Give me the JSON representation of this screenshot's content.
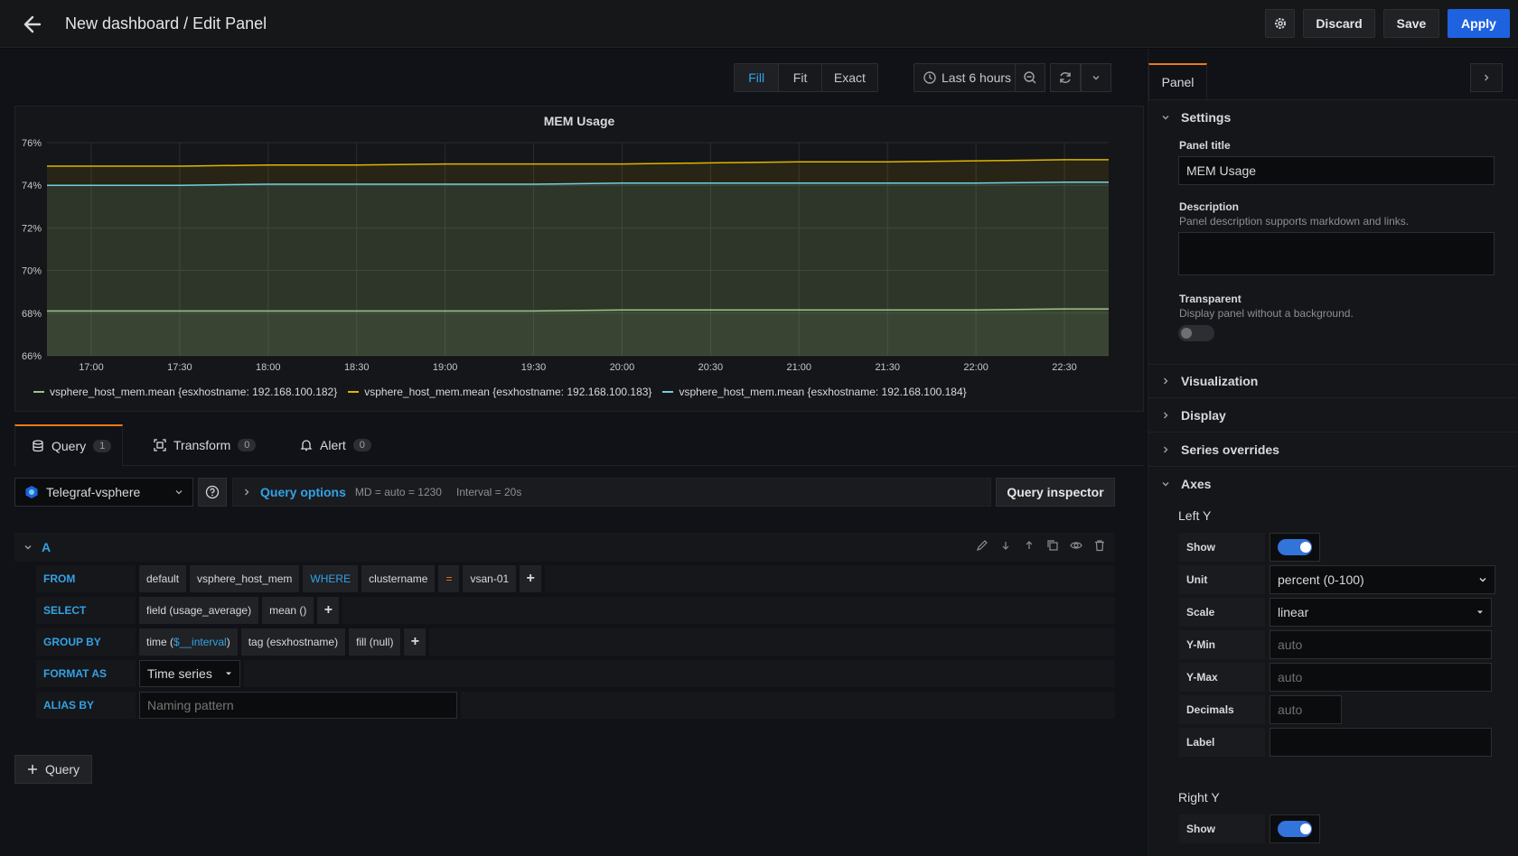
{
  "header": {
    "title": "New dashboard / Edit Panel",
    "discard_label": "Discard",
    "save_label": "Save",
    "apply_label": "Apply"
  },
  "toolbar": {
    "fill_label": "Fill",
    "fit_label": "Fit",
    "exact_label": "Exact",
    "time_range": "Last 6 hours"
  },
  "chart": {
    "title": "MEM Usage"
  },
  "chart_data": {
    "type": "area",
    "title": "MEM Usage",
    "x": [
      "17:00",
      "17:30",
      "18:00",
      "18:30",
      "19:00",
      "19:30",
      "20:00",
      "20:30",
      "21:00",
      "21:30",
      "22:00",
      "22:30"
    ],
    "y_ticks": [
      "76%",
      "74%",
      "72%",
      "70%",
      "68%",
      "66%"
    ],
    "ylim": [
      66,
      76
    ],
    "grid": true,
    "legend_position": "bottom",
    "series": [
      {
        "name": "vsphere_host_mem.mean {esxhostname: 192.168.100.182}",
        "color": "#9ac48a",
        "values": [
          68.1,
          68.1,
          68.1,
          68.1,
          68.1,
          68.1,
          68.15,
          68.15,
          68.15,
          68.15,
          68.15,
          68.2
        ]
      },
      {
        "name": "vsphere_host_mem.mean {esxhostname: 192.168.100.183}",
        "color": "#e0b400",
        "values": [
          74.9,
          74.9,
          74.95,
          74.95,
          75.0,
          75.0,
          75.0,
          75.05,
          75.1,
          75.1,
          75.15,
          75.2
        ]
      },
      {
        "name": "vsphere_host_mem.mean {esxhostname: 192.168.100.184}",
        "color": "#6ed0e0",
        "values": [
          74.0,
          74.0,
          74.05,
          74.05,
          74.05,
          74.05,
          74.1,
          74.1,
          74.1,
          74.1,
          74.1,
          74.15
        ]
      }
    ]
  },
  "tabs": [
    {
      "label": "Query",
      "count": "1"
    },
    {
      "label": "Transform",
      "count": "0"
    },
    {
      "label": "Alert",
      "count": "0"
    }
  ],
  "query_row": {
    "datasource": "Telegraf-vsphere",
    "options_label": "Query options",
    "md_info": "MD = auto = 1230",
    "interval_info": "Interval = 20s",
    "inspector_label": "Query inspector"
  },
  "query": {
    "letter": "A",
    "from": {
      "keyword": "FROM",
      "policy": "default",
      "measurement": "vsphere_host_mem",
      "where": "WHERE",
      "tag_key": "clustername",
      "operator": "=",
      "tag_value": "vsan-01"
    },
    "select": {
      "keyword": "SELECT",
      "field": "field (usage_average)",
      "func": "mean ()"
    },
    "group_by": {
      "keyword": "GROUP BY",
      "time_prefix": "time (",
      "time_var": "$__interval",
      "time_suffix": ")",
      "tag": "tag (esxhostname)",
      "fill": "fill (null)"
    },
    "format_as": {
      "keyword": "FORMAT AS",
      "value": "Time series"
    },
    "alias_by": {
      "keyword": "ALIAS BY",
      "placeholder": "Naming pattern"
    },
    "plus": "+"
  },
  "add_query_label": "Query",
  "right_pane": {
    "tab_label": "Panel",
    "settings": {
      "header": "Settings",
      "panel_title_label": "Panel title",
      "panel_title_value": "MEM Usage",
      "description_label": "Description",
      "description_help": "Panel description supports markdown and links.",
      "transparent_label": "Transparent",
      "transparent_help": "Display panel without a background."
    },
    "sections": {
      "visualization": "Visualization",
      "display": "Display",
      "series_overrides": "Series overrides",
      "axes": "Axes"
    },
    "axes": {
      "left_y": "Left Y",
      "show": "Show",
      "unit": "Unit",
      "unit_value": "percent (0-100)",
      "scale": "Scale",
      "scale_value": "linear",
      "ymin": "Y-Min",
      "ymin_ph": "auto",
      "ymax": "Y-Max",
      "ymax_ph": "auto",
      "decimals": "Decimals",
      "decimals_ph": "auto",
      "label": "Label",
      "right_y": "Right Y",
      "right_show": "Show"
    }
  }
}
